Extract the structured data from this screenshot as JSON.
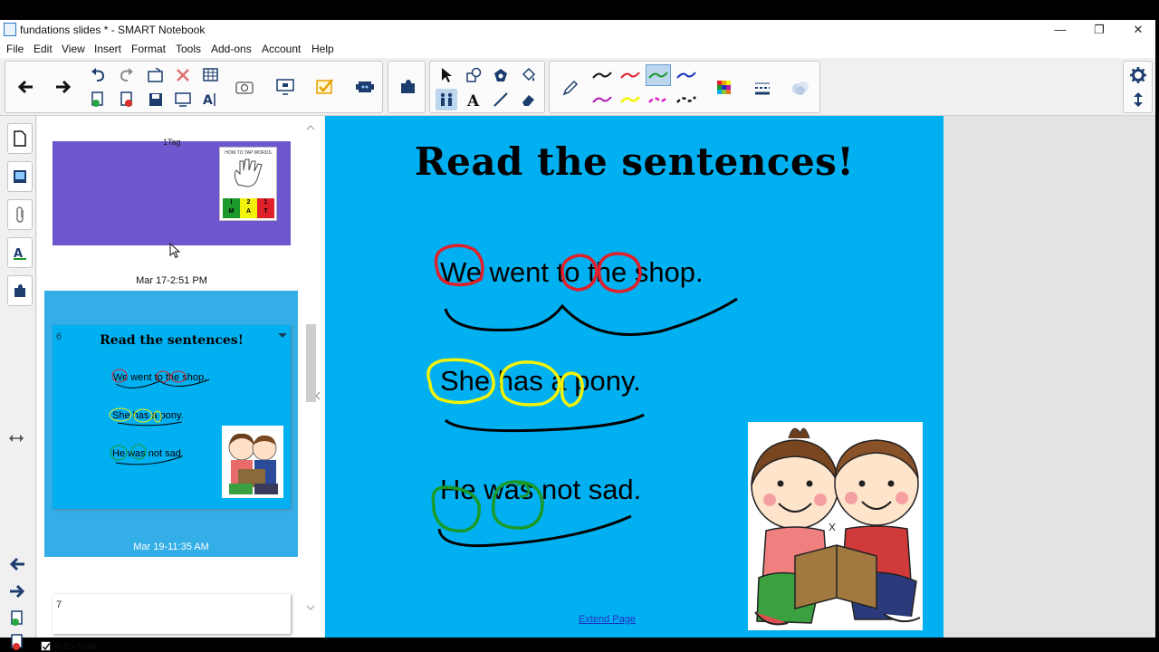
{
  "window": {
    "title": "fundations slides * - SMART Notebook",
    "controls": [
      "—",
      "❐",
      "✕"
    ]
  },
  "menu": [
    "File",
    "Edit",
    "View",
    "Insert",
    "Format",
    "Tools",
    "Add-ons",
    "Account",
    "Help"
  ],
  "sorter": {
    "page5_time": "Mar 17-2:51 PM",
    "page5_partial_text": "1Tag",
    "page5_card_title": "HOW TO TAP WORDS",
    "page5_card_letters": [
      "I",
      "2",
      "1",
      "M",
      "A",
      "T"
    ],
    "page6_number": "6",
    "page6_time": "Mar 19-11:35 AM",
    "page7_number": "7",
    "autohide_label": "Auto-hide"
  },
  "slide": {
    "title": "Read the sentences!",
    "sentences": [
      "We went to the shop.",
      "She has a pony.",
      "He was not sad."
    ],
    "extend_label": "Extend Page"
  },
  "colors": {
    "slide_bg": "#00b0f0",
    "thumb_purple": "#6e56cf",
    "selected_thumb_bg": "#33aee6",
    "ink_red": "#e0202a",
    "ink_yellow": "#f2f20a",
    "ink_green": "#1a9a2a"
  }
}
